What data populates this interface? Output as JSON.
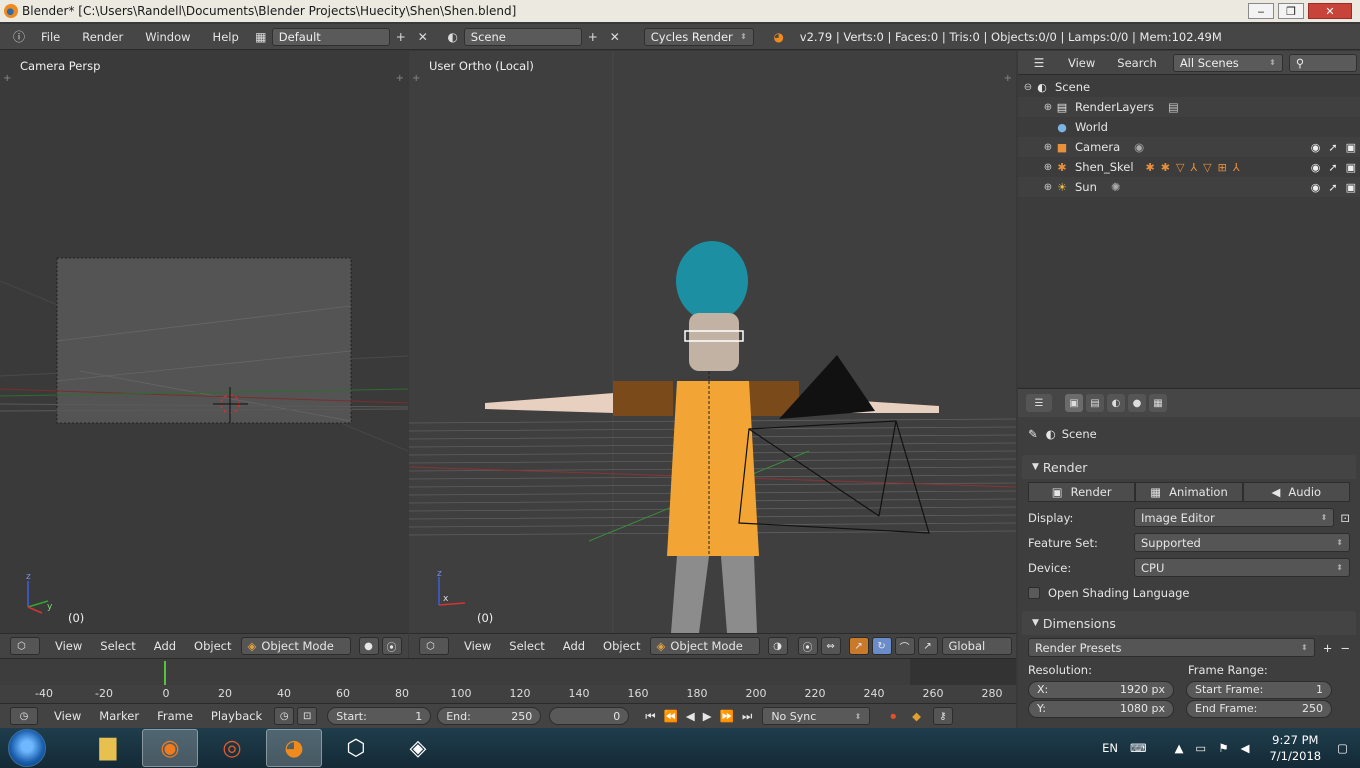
{
  "window": {
    "title": "Blender* [C:\\Users\\Randell\\Documents\\Blender Projects\\Huecity\\Shen\\Shen.blend]",
    "minimize": "‒",
    "maximize": "❐",
    "close": "✕"
  },
  "info_header": {
    "menus": [
      "File",
      "Render",
      "Window",
      "Help"
    ],
    "screen_layout": "Default",
    "scene": "Scene",
    "render_engine": "Cycles Render",
    "stats": "v2.79 | Verts:0 | Faces:0 | Tris:0 | Objects:0/0 | Lamps:0/0 | Mem:102.49M"
  },
  "left_view": {
    "label": "Camera Persp",
    "frame": "(0)",
    "header_menus": [
      "View",
      "Select",
      "Add",
      "Object"
    ],
    "mode": "Object Mode"
  },
  "mid_view": {
    "label": "User Ortho (Local)",
    "frame": "(0)",
    "header_menus": [
      "View",
      "Select",
      "Add",
      "Object"
    ],
    "mode": "Object Mode",
    "orientation": "Global"
  },
  "outliner": {
    "header_menus": [
      "View",
      "Search"
    ],
    "filter": "All Scenes",
    "items": [
      {
        "label": "Scene",
        "icon": "scene-icon",
        "glyph": "◐"
      },
      {
        "label": "RenderLayers",
        "icon": "renderlayers-icon",
        "glyph": "▤"
      },
      {
        "label": "World",
        "icon": "world-icon",
        "glyph": "●"
      },
      {
        "label": "Camera",
        "icon": "camera-icon",
        "glyph": "■"
      },
      {
        "label": "Shen_Skel",
        "icon": "armature-icon",
        "glyph": "✱"
      },
      {
        "label": "Sun",
        "icon": "lamp-icon",
        "glyph": "☀"
      }
    ]
  },
  "properties": {
    "context": "Scene",
    "render_panel": {
      "title": "Render",
      "buttons": [
        "Render",
        "Animation",
        "Audio"
      ],
      "display_label": "Display:",
      "display_value": "Image Editor",
      "feature_label": "Feature Set:",
      "feature_value": "Supported",
      "device_label": "Device:",
      "device_value": "CPU",
      "osl_label": "Open Shading Language"
    },
    "dimensions_panel": {
      "title": "Dimensions",
      "presets": "Render Presets",
      "resolution_label": "Resolution:",
      "frame_range_label": "Frame Range:",
      "res_x_label": "X:",
      "res_x": "1920 px",
      "res_y_label": "Y:",
      "res_y": "1080 px",
      "start_label": "Start Frame:",
      "start": "1",
      "end_label": "End Frame:",
      "end": "250"
    }
  },
  "timeline": {
    "ticks": [
      "-40",
      "-20",
      "0",
      "20",
      "40",
      "60",
      "80",
      "100",
      "120",
      "140",
      "160",
      "180",
      "200",
      "220",
      "240",
      "260",
      "280"
    ],
    "header_menus": [
      "View",
      "Marker",
      "Frame",
      "Playback"
    ],
    "start_label": "Start:",
    "start": "1",
    "end_label": "End:",
    "end": "250",
    "current": "0",
    "sync": "No Sync"
  },
  "taskbar": {
    "language": "EN",
    "time": "9:27 PM",
    "date": "7/1/2018"
  }
}
